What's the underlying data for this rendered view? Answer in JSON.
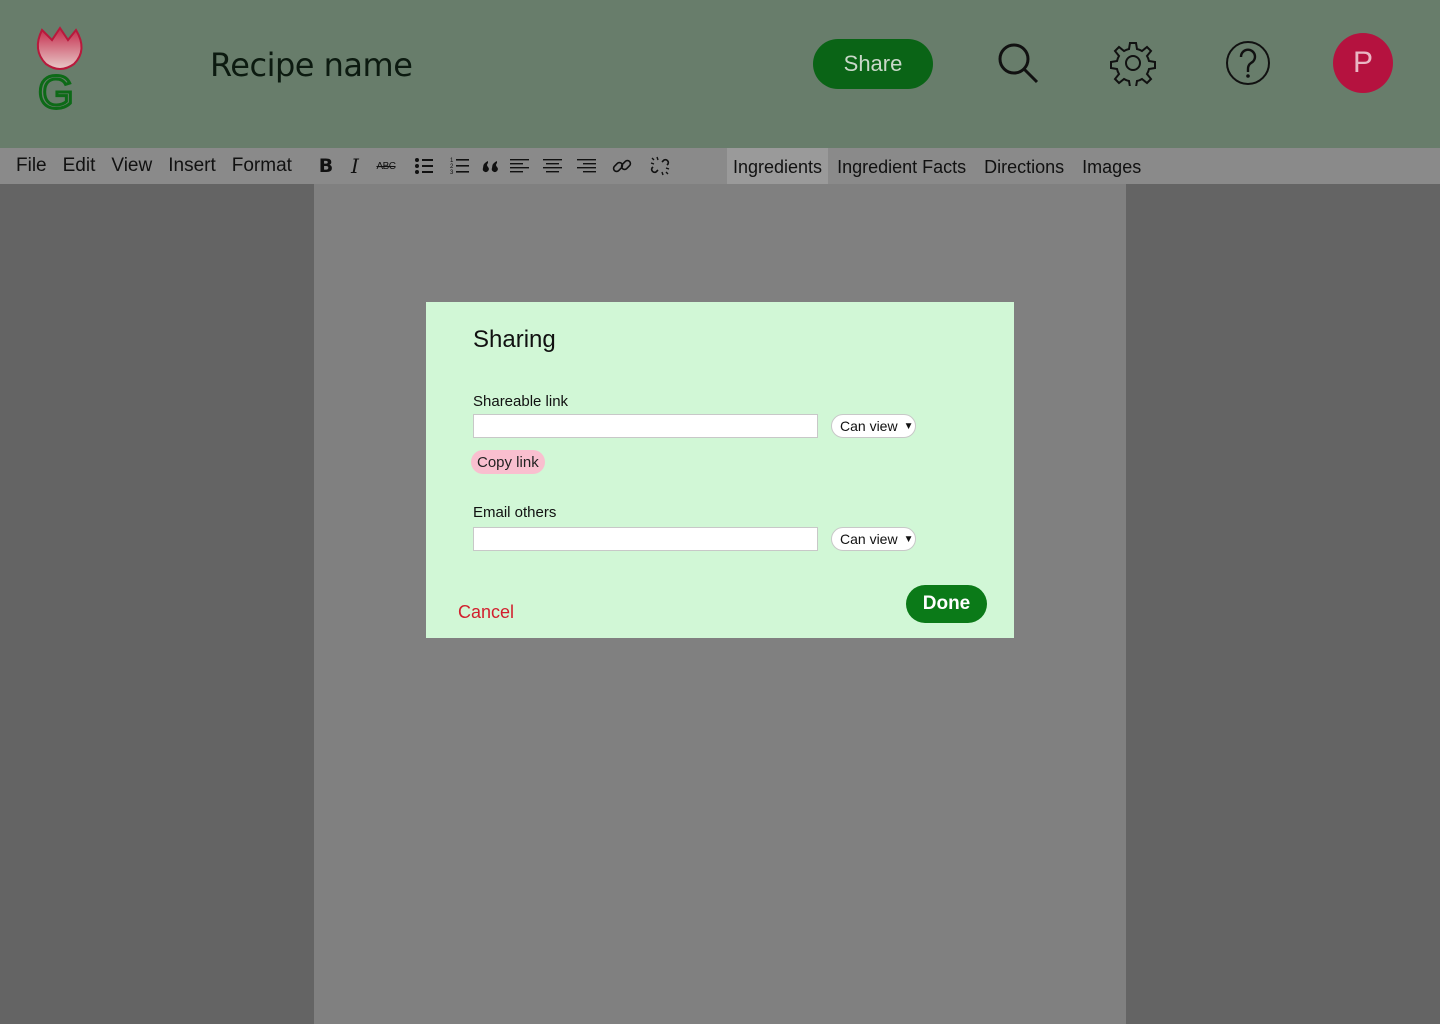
{
  "header": {
    "title": "Recipe name",
    "share_label": "Share",
    "icons": [
      "search-icon",
      "gear-icon",
      "help-icon"
    ],
    "avatar_initial": "P",
    "logo_letter": "G"
  },
  "menu": [
    "File",
    "Edit",
    "View",
    "Insert",
    "Format"
  ],
  "format_tools": [
    "bold",
    "italic",
    "strikethrough",
    "bulleted-list",
    "numbered-list",
    "blockquote",
    "align-left",
    "align-center",
    "align-right",
    "link",
    "unlink"
  ],
  "format_glyphs": {
    "bold": "B",
    "italic": "I",
    "strikethrough": "ABC"
  },
  "tabs": [
    {
      "label": "Ingredients",
      "active": true
    },
    {
      "label": "Ingredient Facts",
      "active": false
    },
    {
      "label": "Directions",
      "active": false
    },
    {
      "label": "Images",
      "active": false
    }
  ],
  "dialog": {
    "title": "Sharing",
    "link_label": "Shareable link",
    "link_value": "",
    "link_permission": "Can view",
    "copy_label": "Copy link",
    "email_label": "Email others",
    "email_value": "",
    "email_permission": "Can view",
    "cancel_label": "Cancel",
    "done_label": "Done"
  },
  "colors": {
    "header_bg": "#687d6b",
    "share_bg": "#0a6416",
    "avatar_bg": "#b5123f",
    "dialog_bg": "#d1f7d6",
    "done_bg": "#0b7a18",
    "copy_bg": "#f9bfcf",
    "cancel_text": "#d21f2e"
  }
}
